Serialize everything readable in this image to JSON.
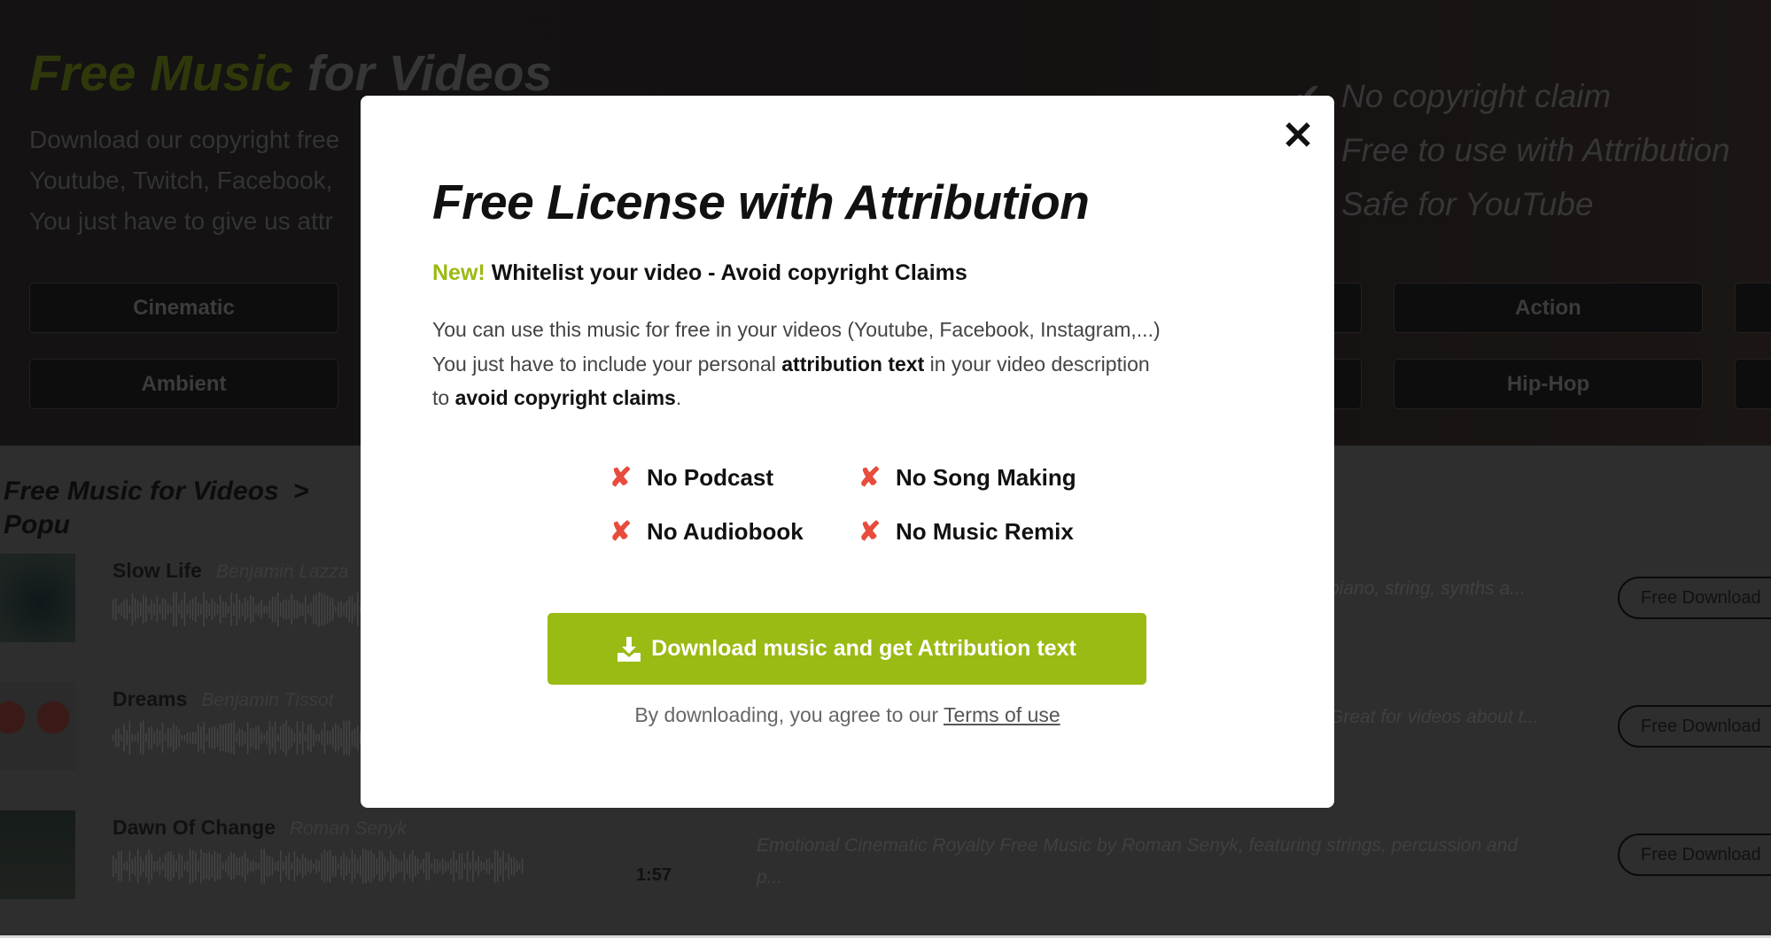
{
  "hero": {
    "title_green": "Free Music",
    "title_rest": "for Videos",
    "subtitle_lines": [
      "Download our copyright free",
      "Youtube, Twitch, Facebook,",
      "You just have to give us attr"
    ],
    "genres": [
      "Cinematic",
      "Action",
      "Ambient",
      "Hip-Hop"
    ],
    "checklist": [
      "No copyright claim",
      "Free to use with Attribution",
      "Safe for YouTube"
    ]
  },
  "breadcrumb": {
    "root": "Free Music for Videos",
    "separator": ">",
    "current": "Popu"
  },
  "tracks": [
    {
      "title": "Slow Life",
      "artist": "Benjamin Lazza",
      "description": "piano, string, synths a...",
      "duration": "",
      "button": "Free Download"
    },
    {
      "title": "Dreams",
      "artist": "Benjamin Tissot",
      "description": "Great for videos about t...",
      "duration": "",
      "button": "Free Download"
    },
    {
      "title": "Dawn Of Change",
      "artist": "Roman Senyk",
      "description": "Emotional Cinematic Royalty Free Music by Roman Senyk, featuring strings, percussion and p...",
      "duration": "1:57",
      "button": "Free Download"
    }
  ],
  "modal": {
    "close_icon": "close-icon",
    "title": "Free License with Attribution",
    "new_label": "New!",
    "new_text": "Whitelist your video - Avoid copyright Claims",
    "para_line1": "You can use this music for free in your videos (Youtube, Facebook, Instagram,...)",
    "para_line2_a": "You just have to include your personal",
    "para_line2_b": "attribution text",
    "para_line2_c": "in your video description",
    "para_line3_a": "to",
    "para_line3_b": "avoid copyright claims",
    "para_line3_c": ".",
    "restrictions": [
      "No Podcast",
      "No Song Making",
      "No Audiobook",
      "No Music Remix"
    ],
    "cta_label": "Download music and get Attribution text",
    "terms_prefix": "By downloading, you agree to our",
    "terms_link": "Terms of use"
  },
  "colors": {
    "accent": "#9aba14",
    "restriction": "#e74c3c"
  }
}
